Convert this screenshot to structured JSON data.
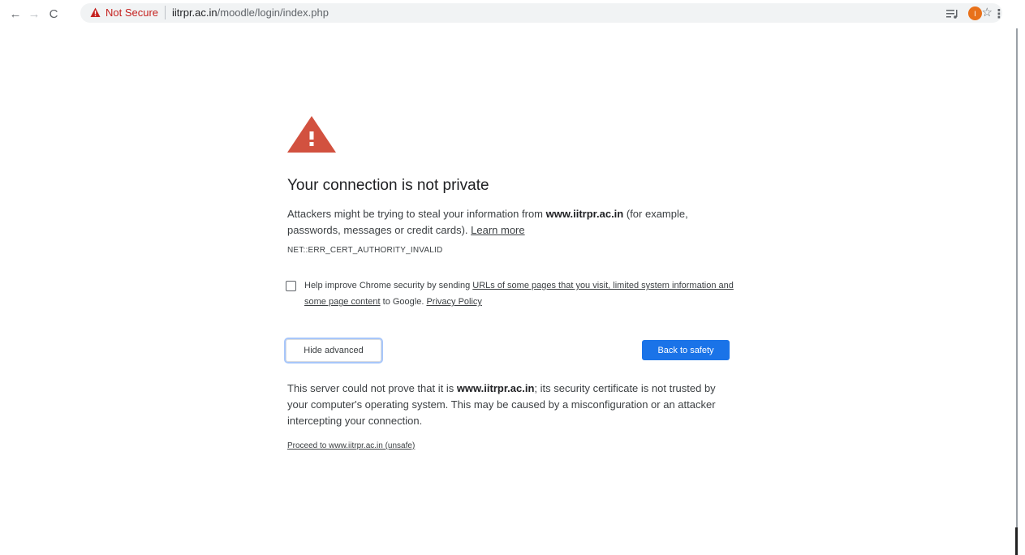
{
  "toolbar": {
    "back": "←",
    "forward": "→",
    "reload": "C",
    "security_label": "Not Secure",
    "url_host": "iitrpr.ac.in",
    "url_path": "/moodle/login/index.php",
    "bookmark": "☆",
    "avatar_letter": "I",
    "menu": "⋮"
  },
  "interstitial": {
    "heading": "Your connection is not private",
    "explanation_before": "Attackers might be trying to steal your information from ",
    "explanation_host": "www.iitrpr.ac.in",
    "explanation_after": " (for example, passwords, messages or credit cards). ",
    "learn_more": "Learn more",
    "error_code": "NET::ERR_CERT_AUTHORITY_INVALID",
    "optin_before": "Help improve Chrome security by sending ",
    "optin_link": "URLs of some pages that you visit, limited system information and some page content",
    "optin_middle": " to Google. ",
    "privacy_policy": "Privacy Policy",
    "hide_advanced": "Hide advanced",
    "back_to_safety": "Back to safety",
    "details_before": "This server could not prove that it is ",
    "details_host": "www.iitrpr.ac.in",
    "details_after": "; its security certificate is not trusted by your computer's operating system. This may be caused by a misconfiguration or an attacker intercepting your connection.",
    "proceed": "Proceed to www.iitrpr.ac.in (unsafe)"
  },
  "colors": {
    "warning_red": "#d2513f",
    "primary_blue": "#1a73e8",
    "avatar": "#e8711a"
  }
}
